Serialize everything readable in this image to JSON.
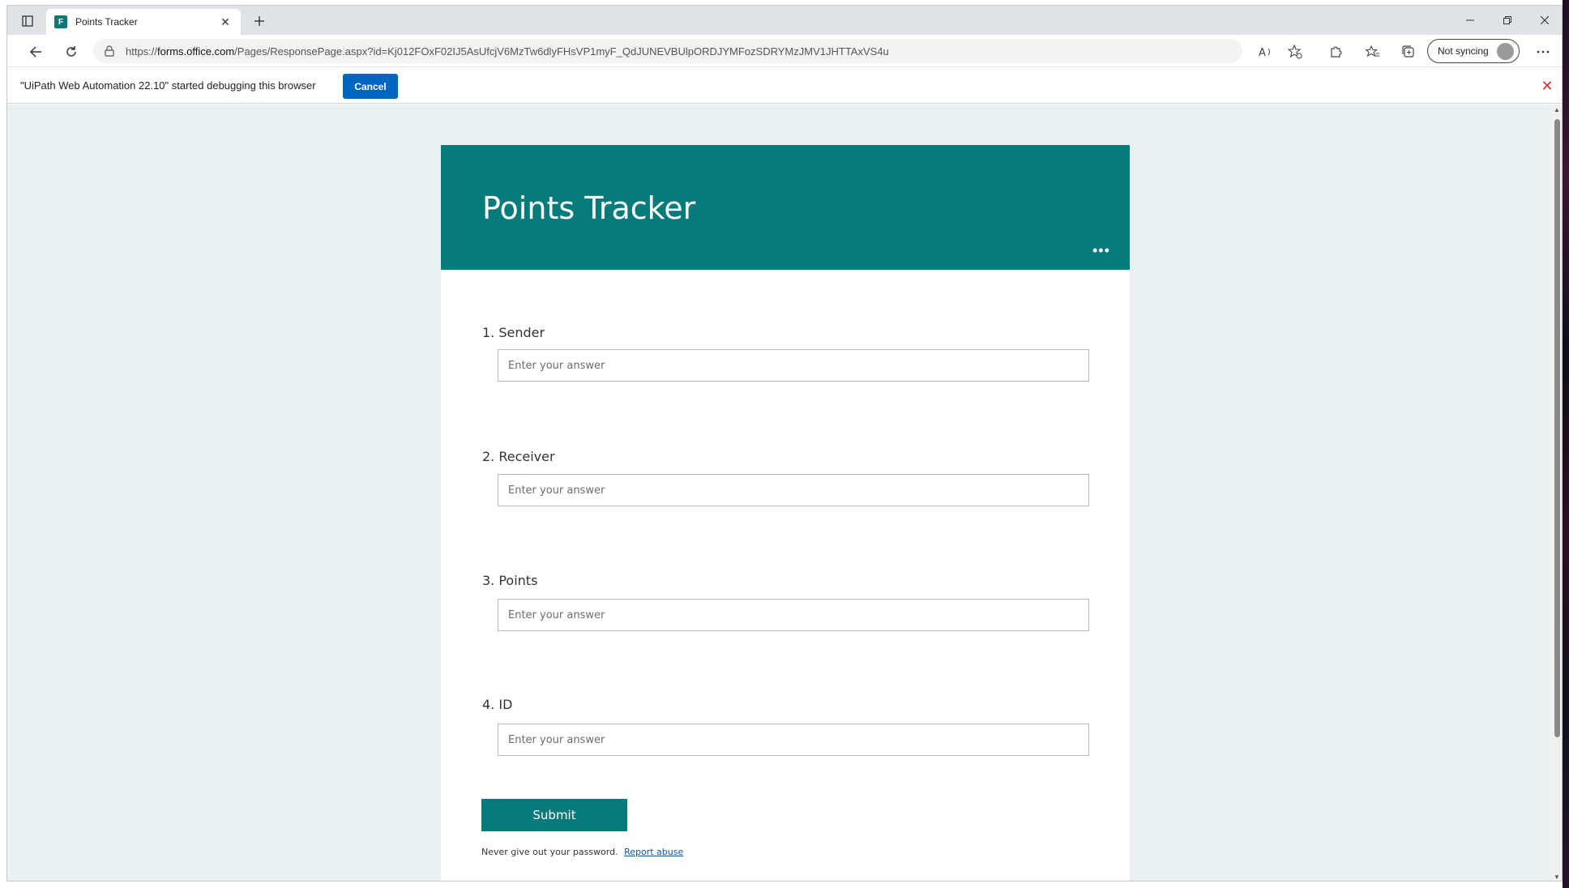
{
  "browser": {
    "tab_title": "Points Tracker",
    "tab_favicon_text": "F",
    "url_prefix": "https://",
    "url_host": "forms.office.com",
    "url_rest": "/Pages/ResponsePage.aspx?id=Kj012FOxF02IJ5AsUfcjV6MzTw6dlyFHsVP1myF_QdJUNEVBUlpORDJYMFozSDRYMzJMV1JHTTAxVS4u",
    "sync_label": "Not syncing"
  },
  "infobar": {
    "message": "\"UiPath Web Automation 22.10\" started debugging this browser",
    "cancel_label": "Cancel"
  },
  "form": {
    "title": "Points Tracker",
    "questions": [
      {
        "label": "1. Sender",
        "placeholder": "Enter your answer"
      },
      {
        "label": "2. Receiver",
        "placeholder": "Enter your answer"
      },
      {
        "label": "3. Points",
        "placeholder": "Enter your answer"
      },
      {
        "label": "4. ID",
        "placeholder": "Enter your answer"
      }
    ],
    "submit_label": "Submit",
    "footer_text": "Never give out your password.",
    "report_link": "Report abuse"
  },
  "colors": {
    "accent": "#077a7c",
    "page_bg": "#e9f0f2",
    "cancel_button": "#0067c0"
  }
}
